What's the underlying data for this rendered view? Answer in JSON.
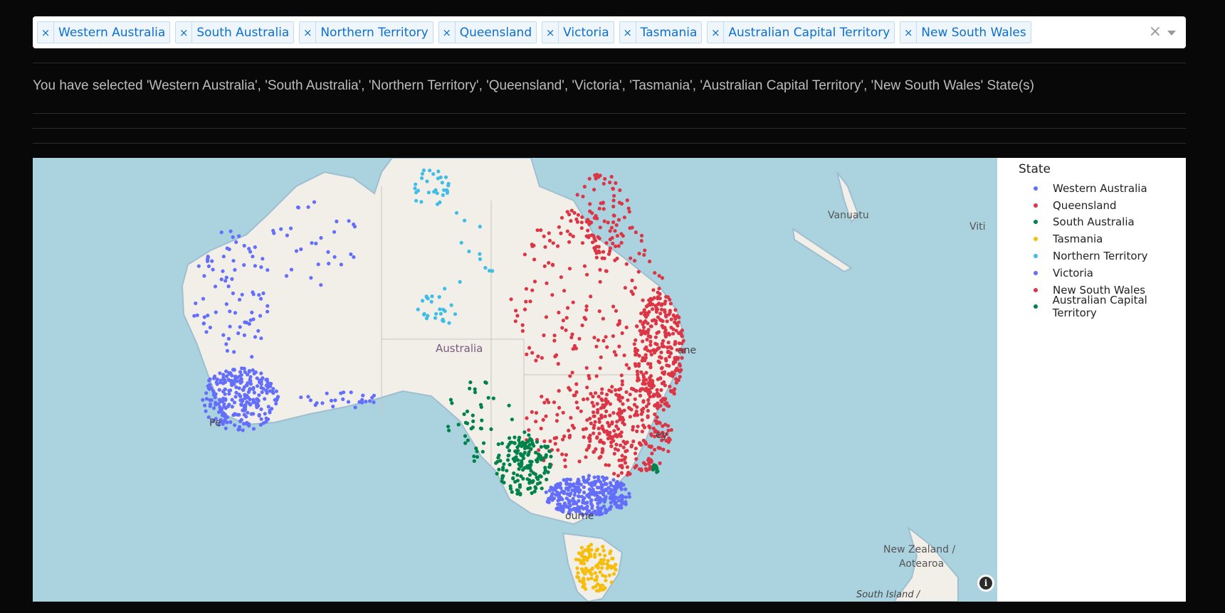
{
  "dropdown": {
    "tags": [
      {
        "label": "Western Australia"
      },
      {
        "label": "South Australia"
      },
      {
        "label": "Northern Territory"
      },
      {
        "label": "Queensland"
      },
      {
        "label": "Victoria"
      },
      {
        "label": "Tasmania"
      },
      {
        "label": "Australian Capital Territory"
      },
      {
        "label": "New South Wales"
      }
    ],
    "remove_glyph": "×",
    "clear_glyph": "×"
  },
  "selected_message": "You have selected 'Western Australia', 'South Australia', 'Northern Territory', 'Queensland', 'Victoria', 'Tasmania', 'Australian Capital Territory', 'New South Wales' State(s)",
  "map": {
    "place_labels": [
      "Australia",
      "Vanuatu",
      "Viti",
      "New Zealand /",
      "Aotearoa",
      "South Island /",
      "Pe",
      "ane",
      "ey",
      "ourne"
    ],
    "colors": {
      "ocean": "#aad3df",
      "land": "#f2efe9",
      "border": "#c8c4bf"
    },
    "info_icon": "info-icon"
  },
  "legend": {
    "title": "State",
    "items": [
      {
        "label": "Western Australia",
        "color": "#636efa"
      },
      {
        "label": "Queensland",
        "color": "#dc3545"
      },
      {
        "label": "South Australia",
        "color": "#00824a"
      },
      {
        "label": "Tasmania",
        "color": "#f6bd0b"
      },
      {
        "label": "Northern Territory",
        "color": "#3fbde6"
      },
      {
        "label": "Victoria",
        "color": "#636efa"
      },
      {
        "label": "New South Wales",
        "color": "#dc3545"
      },
      {
        "label": "Australian Capital Territory",
        "color": "#00824a"
      }
    ]
  }
}
